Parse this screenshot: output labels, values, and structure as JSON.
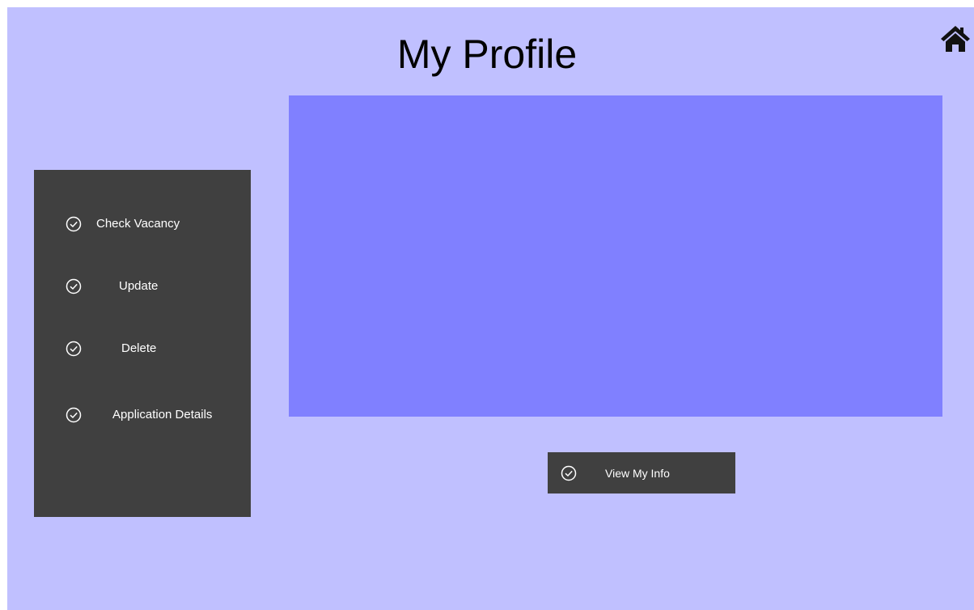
{
  "window": {
    "title": "My Profile"
  },
  "home": {
    "icon": "home-icon"
  },
  "sidebar": {
    "items": [
      {
        "label": "Check Vacancy",
        "icon": "check-circle-icon"
      },
      {
        "label": "Update",
        "icon": "check-circle-icon"
      },
      {
        "label": "Delete",
        "icon": "check-circle-icon"
      },
      {
        "label": "Application Details",
        "icon": "check-circle-icon"
      }
    ]
  },
  "actions": {
    "view_info_label": "View My Info",
    "view_info_icon": "check-circle-icon"
  },
  "colors": {
    "background": "#c0c0ff",
    "panel": "#8080ff",
    "sidebar": "#404040",
    "text_light": "#ffffff"
  }
}
